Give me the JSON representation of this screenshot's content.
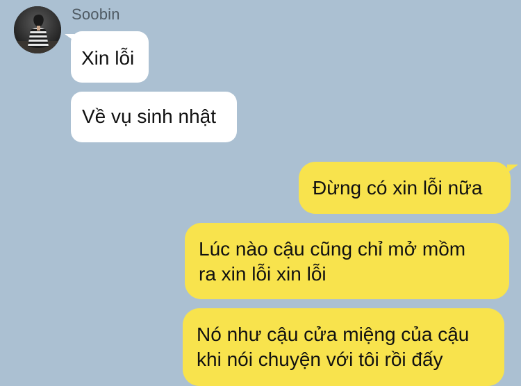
{
  "chat": {
    "sender": {
      "name": "Soobin",
      "avatar_icon": "avatar-photo-icon"
    },
    "messages": [
      {
        "direction": "incoming",
        "lines": [
          "Xin lỗi"
        ]
      },
      {
        "direction": "incoming",
        "lines": [
          "Về vụ sinh nhật"
        ]
      },
      {
        "direction": "outgoing",
        "lines": [
          "Đừng có xin lỗi nữa"
        ]
      },
      {
        "direction": "outgoing",
        "lines": [
          "Lúc nào cậu cũng chỉ mở mồm",
          "ra xin lỗi xin lỗi"
        ]
      },
      {
        "direction": "outgoing",
        "lines": [
          "Nó như cậu cửa miệng của cậu",
          "khi nói chuyện với tôi rồi đấy"
        ]
      }
    ]
  },
  "colors": {
    "background": "#abc0d2",
    "incoming_bubble": "#ffffff",
    "outgoing_bubble": "#f8e34d",
    "sender_name": "#4f5a63"
  }
}
